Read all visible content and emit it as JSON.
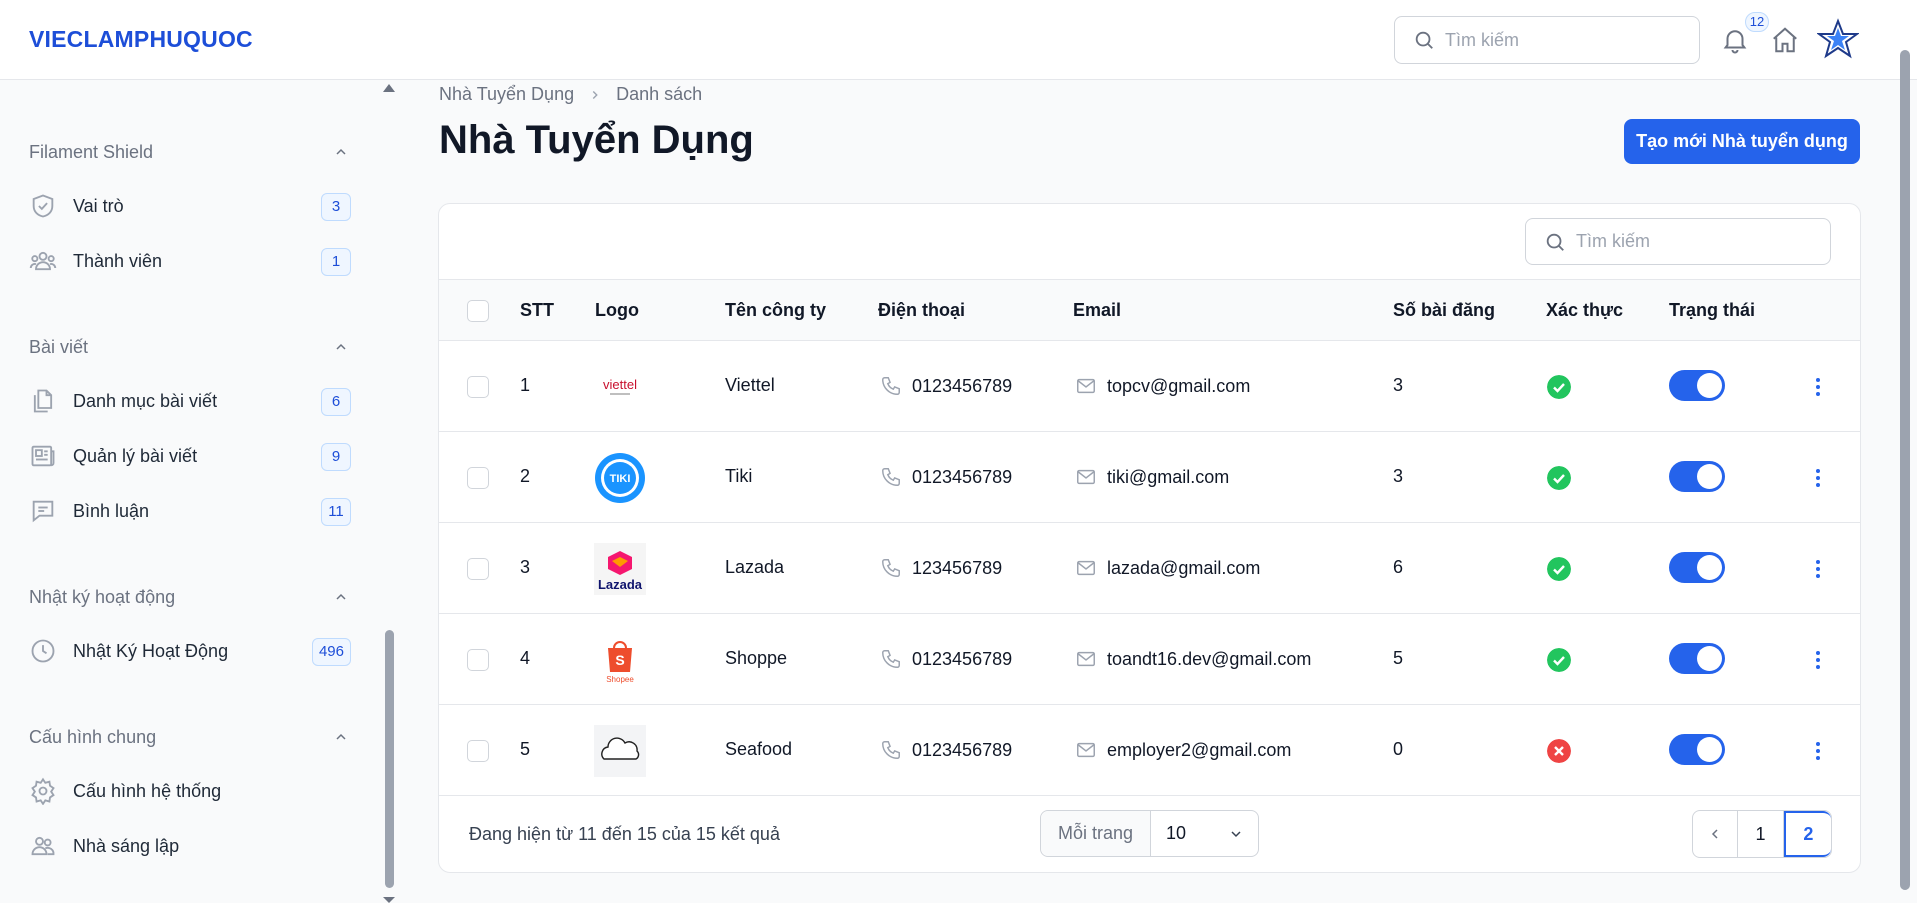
{
  "app": {
    "brand": "VIECLAMPHUQUOC"
  },
  "topbar": {
    "search_placeholder": "Tìm kiếm",
    "notification_count": "12"
  },
  "sidebar": {
    "groups": [
      {
        "title": "Filament Shield",
        "items": [
          {
            "label": "Vai trò",
            "count": "3",
            "icon": "shield-icon"
          },
          {
            "label": "Thành viên",
            "count": "1",
            "icon": "users-icon"
          }
        ]
      },
      {
        "title": "Bài viết",
        "items": [
          {
            "label": "Danh mục bài viết",
            "count": "6",
            "icon": "documents-icon"
          },
          {
            "label": "Quản lý bài viết",
            "count": "9",
            "icon": "newspaper-icon"
          },
          {
            "label": "Bình luận",
            "count": "11",
            "icon": "comment-icon"
          }
        ]
      },
      {
        "title": "Nhật ký hoạt động",
        "items": [
          {
            "label": "Nhật Ký Hoạt Động",
            "count": "496",
            "icon": "clock-icon"
          }
        ]
      },
      {
        "title": "Cấu hình chung",
        "items": [
          {
            "label": "Cấu hình hệ thống",
            "icon": "gear-icon"
          },
          {
            "label": "Nhà sáng lập",
            "icon": "users-icon"
          }
        ]
      }
    ]
  },
  "breadcrumb": {
    "parent": "Nhà Tuyển Dụng",
    "current": "Danh sách"
  },
  "page": {
    "title": "Nhà Tuyển Dụng",
    "create_label": "Tạo mới Nhà tuyển dụng"
  },
  "table": {
    "search_placeholder": "Tìm kiếm",
    "columns": {
      "stt": "STT",
      "logo": "Logo",
      "company": "Tên công ty",
      "phone": "Điện thoại",
      "email": "Email",
      "posts": "Số bài đăng",
      "verified": "Xác thực",
      "status": "Trạng thái"
    },
    "rows": [
      {
        "stt": "1",
        "logo": "viettel",
        "company": "Viettel",
        "phone": "0123456789",
        "email": "topcv@gmail.com",
        "posts": "3",
        "verified": true,
        "active": true
      },
      {
        "stt": "2",
        "logo": "tiki",
        "company": "Tiki",
        "phone": "0123456789",
        "email": "tiki@gmail.com",
        "posts": "3",
        "verified": true,
        "active": true
      },
      {
        "stt": "3",
        "logo": "lazada",
        "company": "Lazada",
        "phone": "123456789",
        "email": "lazada@gmail.com",
        "posts": "6",
        "verified": true,
        "active": true
      },
      {
        "stt": "4",
        "logo": "shopee",
        "company": "Shoppe",
        "phone": "0123456789",
        "email": "toandt16.dev@gmail.com",
        "posts": "5",
        "verified": true,
        "active": true
      },
      {
        "stt": "5",
        "logo": "cloud",
        "company": "Seafood",
        "phone": "0123456789",
        "email": "employer2@gmail.com",
        "posts": "0",
        "verified": false,
        "active": true
      }
    ],
    "logo_text": {
      "viettel": "viettel",
      "tiki": "TIKI",
      "lazada": "Lazada",
      "shopee": "Shopee"
    }
  },
  "footer": {
    "summary": "Đang hiện từ 11 đến 15 của 15 kết quả",
    "per_page_label": "Mỗi trang",
    "per_page_value": "10",
    "pages": [
      "1",
      "2"
    ],
    "current_page": "2"
  },
  "colors": {
    "accent": "#2563eb",
    "success": "#22c55e",
    "danger": "#ef4444"
  }
}
